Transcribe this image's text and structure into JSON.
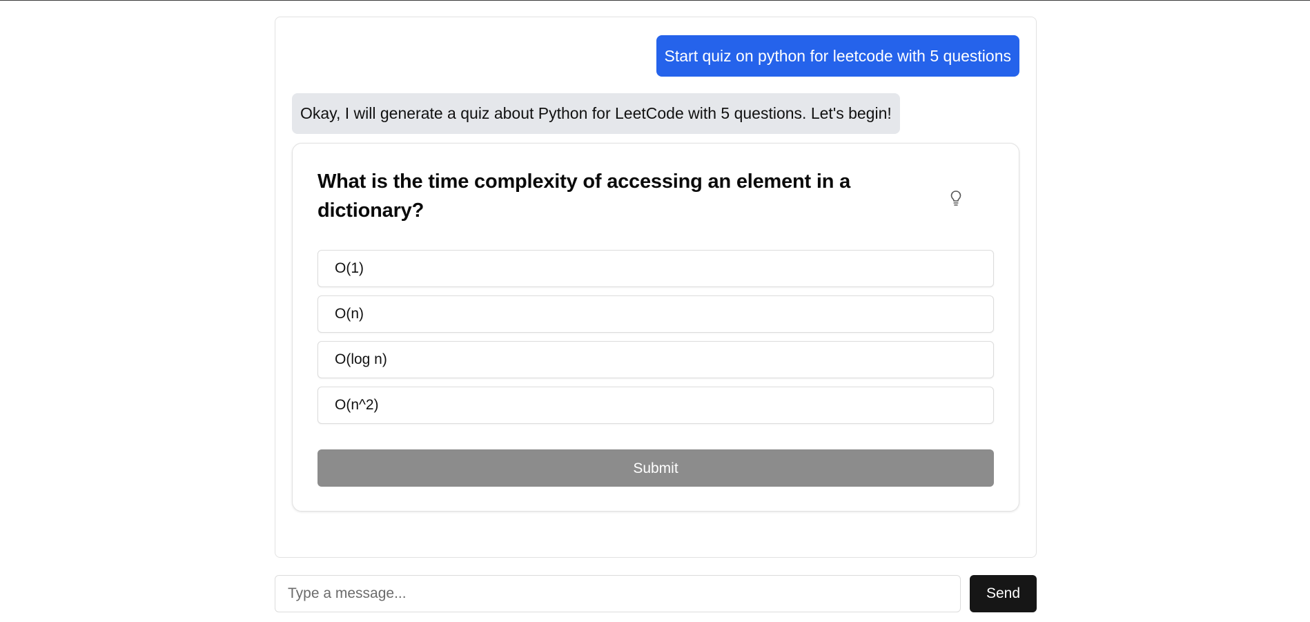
{
  "messages": {
    "user": "Start quiz on python for leetcode with 5 questions",
    "assistant": "Okay, I will generate a quiz about Python for LeetCode with 5 questions. Let's begin!"
  },
  "quiz": {
    "question": "What is the time complexity of accessing an element in a dictionary?",
    "hint_icon": "lightbulb-icon",
    "options": [
      "O(1)",
      "O(n)",
      "O(log n)",
      "O(n^2)"
    ],
    "submit_label": "Submit"
  },
  "composer": {
    "placeholder": "Type a message...",
    "send_label": "Send"
  },
  "colors": {
    "user_bubble": "#2563eb",
    "assistant_bubble": "#e5e7eb",
    "submit_disabled": "#8c8c8c",
    "send_button": "#161616"
  }
}
